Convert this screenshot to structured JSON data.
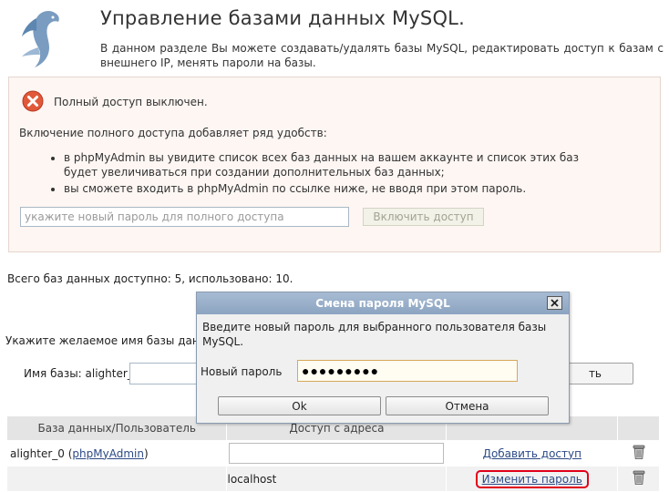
{
  "header": {
    "title": "Управление базами данных MySQL.",
    "description": "В данном разделе Вы можете создавать/удалять базы MySQL, редактировать доступ к базам с внешнего IP, менять пароли на базы."
  },
  "warning": {
    "title": "Полный доступ выключен.",
    "intro": "Включение полного доступа добавляет ряд удобств:",
    "items": [
      "в phpMyAdmin вы увидите список всех баз данных на вашем аккаунте и список этих баз будет увеличиваться при создании дополнительных баз данных;",
      "вы сможете входить в phpMyAdmin по ссылке ниже, не вводя при этом пароль."
    ],
    "input_placeholder": "укажите новый пароль для полного доступа",
    "button_label": "Включить доступ"
  },
  "db_count_text": "Всего баз данных доступно: 5, использовано: 10.",
  "create": {
    "prompt": "Укажите желаемое имя базы данн",
    "label": "Имя базы: alighter_",
    "button_label": "ть"
  },
  "table": {
    "headers": [
      "База данных/Пользователь",
      "Доступ с адреса",
      "",
      ""
    ],
    "rows": [
      {
        "db": "alighter_0",
        "db_link_open": " (",
        "link": "phpMyAdmin",
        "db_link_close": ")",
        "action": "Добавить доступ"
      },
      {
        "address": "localhost",
        "action": "Изменить пароль"
      }
    ]
  },
  "dialog": {
    "title": "Смена пароля MySQL",
    "message": "Введите новый пароль для выбранного пользователя базы MySQL.",
    "field_label": "Новый пароль",
    "field_value": "●●●●●●●●●",
    "ok_label": "Ok",
    "cancel_label": "Отмена"
  },
  "colors": {
    "highlight": "#e1001a",
    "dialog_title": "#8ca4c1",
    "link": "#2c4a86",
    "error_icon": "#e05a3a"
  },
  "icons": {
    "logo": "mysql-dolphin-icon",
    "error": "error-x-icon",
    "delete": "trash-icon",
    "close": "close-icon"
  }
}
